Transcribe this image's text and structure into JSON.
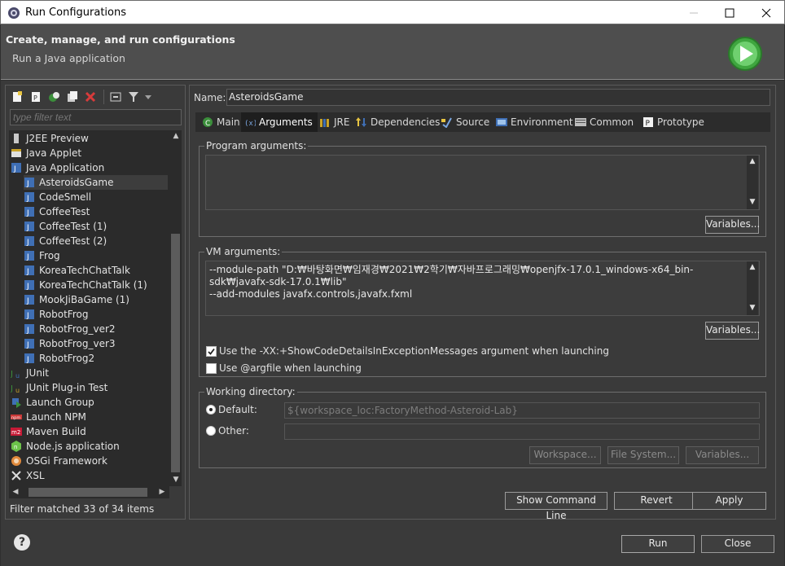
{
  "window": {
    "title": "Run Configurations"
  },
  "header": {
    "title": "Create, manage, and run configurations",
    "subtitle": "Run a Java application"
  },
  "left": {
    "filter_placeholder": "type filter text",
    "tree": [
      {
        "label": "J2EE Preview",
        "indent": 0,
        "icon": "j2ee-preview-icon"
      },
      {
        "label": "Java Applet",
        "indent": 0,
        "icon": "java-applet-icon"
      },
      {
        "label": "Java Application",
        "indent": 0,
        "icon": "java-application-icon"
      },
      {
        "label": "AsteroidsGame",
        "indent": 1,
        "icon": "java-class-icon"
      },
      {
        "label": "CodeSmell",
        "indent": 1,
        "icon": "java-class-icon"
      },
      {
        "label": "CoffeeTest",
        "indent": 1,
        "icon": "java-class-icon"
      },
      {
        "label": "CoffeeTest (1)",
        "indent": 1,
        "icon": "java-class-icon"
      },
      {
        "label": "CoffeeTest (2)",
        "indent": 1,
        "icon": "java-class-icon"
      },
      {
        "label": "Frog",
        "indent": 1,
        "icon": "java-class-icon"
      },
      {
        "label": "KoreaTechChatTalk",
        "indent": 1,
        "icon": "java-class-icon"
      },
      {
        "label": "KoreaTechChatTalk (1)",
        "indent": 1,
        "icon": "java-class-icon"
      },
      {
        "label": "MookJiBaGame (1)",
        "indent": 1,
        "icon": "java-class-icon"
      },
      {
        "label": "RobotFrog",
        "indent": 1,
        "icon": "java-class-icon"
      },
      {
        "label": "RobotFrog_ver2",
        "indent": 1,
        "icon": "java-class-icon"
      },
      {
        "label": "RobotFrog_ver3",
        "indent": 1,
        "icon": "java-class-icon"
      },
      {
        "label": "RobotFrog2",
        "indent": 1,
        "icon": "java-class-icon"
      },
      {
        "label": "JUnit",
        "indent": 0,
        "icon": "junit-icon"
      },
      {
        "label": "JUnit Plug-in Test",
        "indent": 0,
        "icon": "junit-plugin-icon"
      },
      {
        "label": "Launch Group",
        "indent": 0,
        "icon": "launch-group-icon"
      },
      {
        "label": "Launch NPM",
        "indent": 0,
        "icon": "npm-icon"
      },
      {
        "label": "Maven Build",
        "indent": 0,
        "icon": "maven-icon"
      },
      {
        "label": "Node.js application",
        "indent": 0,
        "icon": "nodejs-icon"
      },
      {
        "label": "OSGi Framework",
        "indent": 0,
        "icon": "osgi-icon"
      },
      {
        "label": "XSL",
        "indent": 0,
        "icon": "xsl-icon"
      }
    ],
    "status": "Filter matched 33 of 34 items"
  },
  "right": {
    "name_label": "Name:",
    "name_value": "AsteroidsGame",
    "tabs": [
      {
        "label": "Main",
        "icon": "main-tab-icon",
        "active": false
      },
      {
        "label": "Arguments",
        "icon": "arguments-tab-icon",
        "active": true
      },
      {
        "label": "JRE",
        "icon": "jre-tab-icon",
        "active": false
      },
      {
        "label": "Dependencies",
        "icon": "dependencies-tab-icon",
        "active": false
      },
      {
        "label": "Source",
        "icon": "source-tab-icon",
        "active": false
      },
      {
        "label": "Environment",
        "icon": "environment-tab-icon",
        "active": false
      },
      {
        "label": "Common",
        "icon": "common-tab-icon",
        "active": false
      },
      {
        "label": "Prototype",
        "icon": "prototype-tab-icon",
        "active": false
      }
    ],
    "program_args": {
      "legend": "Program arguments:",
      "value": "",
      "variables": "Variables..."
    },
    "vm_args": {
      "legend": "VM arguments:",
      "value": "--module-path \"D:₩바탕화면₩임재경₩2021₩2학기₩자바프로그래밍₩openjfx-17.0.1_windows-x64_bin-sdk₩javafx-sdk-17.0.1₩lib\"\n--add-modules javafx.controls,javafx.fxml",
      "variables": "Variables...",
      "show_details_label": "Use the -XX:+ShowCodeDetailsInExceptionMessages argument when launching",
      "show_details_checked": true,
      "argfile_label": "Use @argfile when launching",
      "argfile_checked": false
    },
    "working_dir": {
      "legend": "Working directory:",
      "default_label": "Default:",
      "default_value": "${workspace_loc:FactoryMethod-Asteroid-Lab}",
      "other_label": "Other:",
      "other_value": "",
      "workspace_btn": "Workspace...",
      "filesystem_btn": "File System...",
      "variables_btn": "Variables..."
    },
    "show_command_line": "Show Command Line",
    "revert": "Revert",
    "apply": "Apply"
  },
  "footer": {
    "run": "Run",
    "close": "Close",
    "help": "?"
  },
  "colors": {
    "accent_green": "#3fa63f",
    "error_red": "#d83b3b",
    "background": "#3a3a3a"
  }
}
